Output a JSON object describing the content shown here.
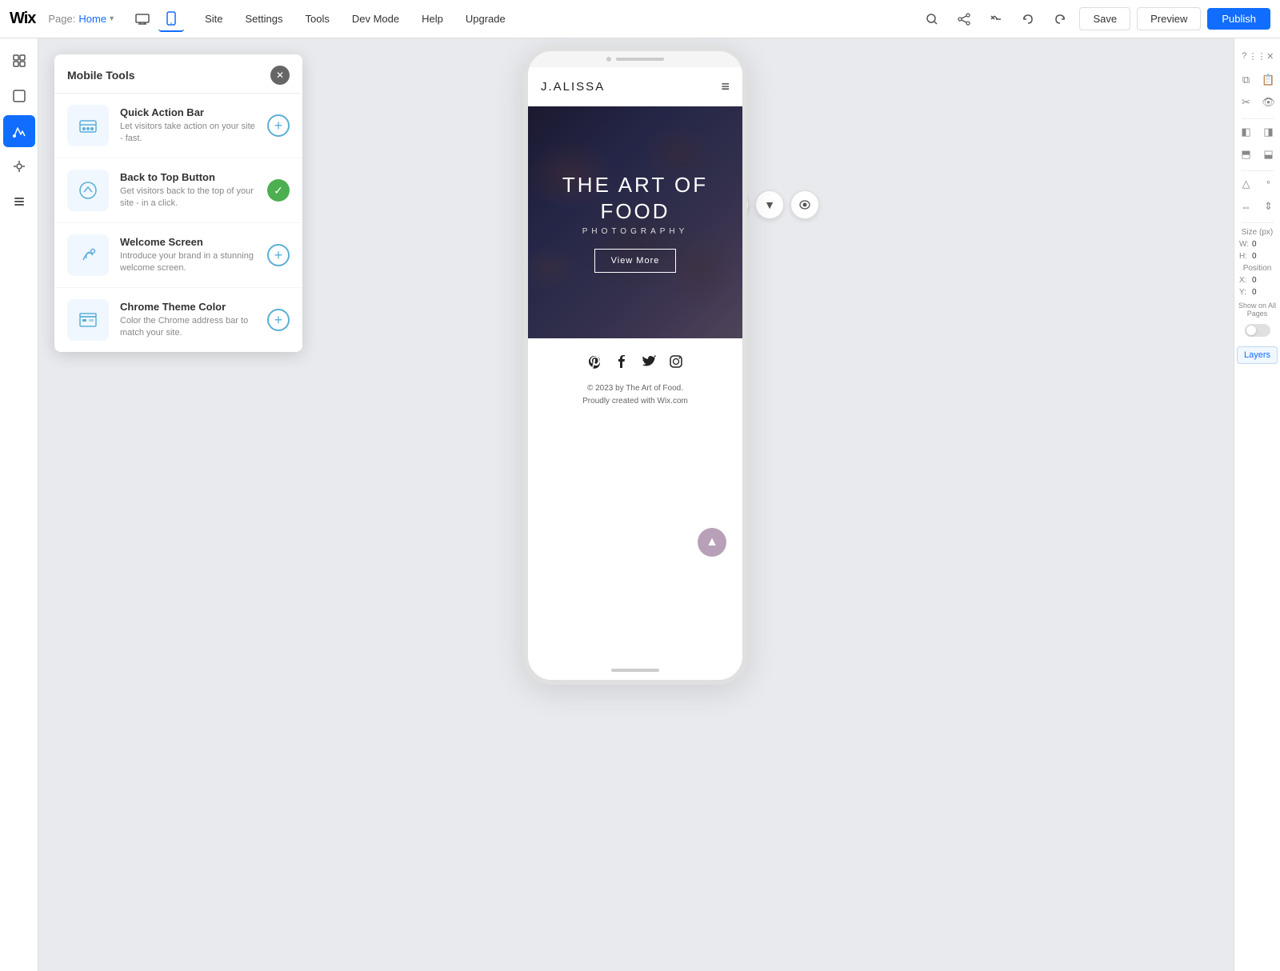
{
  "topbar": {
    "logo": "Wix",
    "page_label": "Page:",
    "page_name": "Home",
    "devices": [
      {
        "icon": "🖥",
        "label": "desktop",
        "active": false
      },
      {
        "icon": "📱",
        "label": "mobile",
        "active": true
      }
    ],
    "nav_items": [
      "Site",
      "Settings",
      "Tools",
      "Dev Mode",
      "Help",
      "Upgrade"
    ],
    "save_label": "Save",
    "preview_label": "Preview",
    "publish_label": "Publish"
  },
  "left_sidebar": {
    "icons": [
      {
        "name": "pages-icon",
        "symbol": "⊞",
        "active": false
      },
      {
        "name": "elements-icon",
        "symbol": "⬜",
        "active": false
      },
      {
        "name": "design-icon",
        "symbol": "🔧",
        "active": true
      },
      {
        "name": "apps-icon",
        "symbol": "👁",
        "active": false
      },
      {
        "name": "layers-icon",
        "symbol": "▤",
        "active": false
      }
    ]
  },
  "mobile_tools": {
    "title": "Mobile Tools",
    "tools": [
      {
        "name": "Quick Action Bar",
        "desc": "Let visitors take action on your site - fast.",
        "icon": "📱",
        "status": "add"
      },
      {
        "name": "Back to Top Button",
        "desc": "Get visitors back to the top of your site - in a click.",
        "icon": "⬆",
        "status": "enabled"
      },
      {
        "name": "Welcome Screen",
        "desc": "Introduce your brand in a stunning welcome screen.",
        "icon": "👋",
        "status": "add"
      },
      {
        "name": "Chrome Theme Color",
        "desc": "Color the Chrome address bar to match your site.",
        "icon": "⬛",
        "status": "add"
      }
    ]
  },
  "phone_preview": {
    "site_logo": "J.ALISSA",
    "hero_title": "THE ART OF\nFOOD",
    "hero_subtitle": "PHOTOGRAPHY",
    "view_more_btn": "View More",
    "footer_copy_line1": "© 2023 by The Art of Food.",
    "footer_copy_line2": "Proudly created with Wix.com",
    "social_icons": [
      "pinterest",
      "facebook",
      "twitter",
      "instagram"
    ]
  },
  "right_panel": {
    "question_label": "?",
    "size_label": "Size (px)",
    "w_label": "W:",
    "w_value": "0",
    "h_label": "H:",
    "h_value": "0",
    "position_label": "Position",
    "x_label": "X:",
    "x_value": "0",
    "y_label": "Y:",
    "y_value": "0",
    "show_all_pages": "Show on All\nPages",
    "layers_btn": "Layers"
  }
}
